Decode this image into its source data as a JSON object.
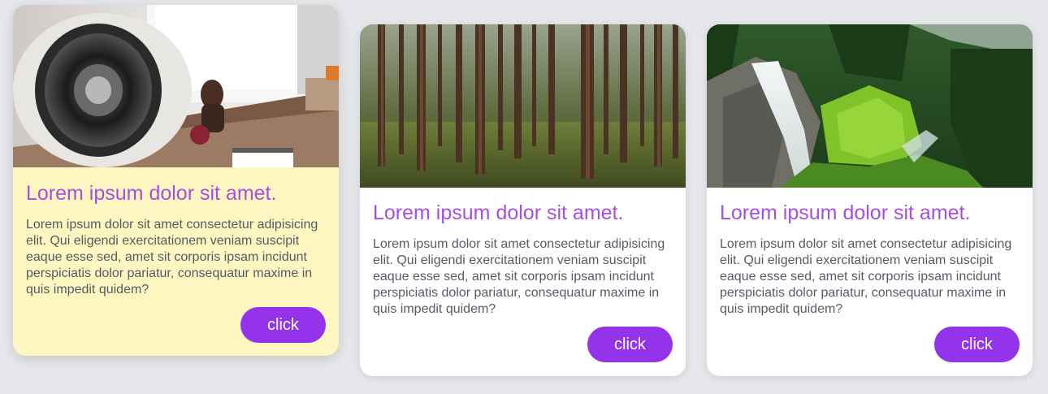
{
  "cards": [
    {
      "image": "desk-speaker-photo",
      "title": "Lorem ipsum dolor sit amet.",
      "text": "Lorem ipsum dolor sit amet consectetur adipisicing elit. Qui eligendi exercitationem veniam suscipit eaque esse sed, amet sit corporis ipsam incidunt perspiciatis dolor pariatur, consequatur maxime in quis impedit quidem?",
      "button_label": "click",
      "active": true
    },
    {
      "image": "pine-forest-photo",
      "title": "Lorem ipsum dolor sit amet.",
      "text": "Lorem ipsum dolor sit amet consectetur adipisicing elit. Qui eligendi exercitationem veniam suscipit eaque esse sed, amet sit corporis ipsam incidunt perspiciatis dolor pariatur, consequatur maxime in quis impedit quidem?",
      "button_label": "click",
      "active": false
    },
    {
      "image": "waterfall-photo",
      "title": "Lorem ipsum dolor sit amet.",
      "text": "Lorem ipsum dolor sit amet consectetur adipisicing elit. Qui eligendi exercitationem veniam suscipit eaque esse sed, amet sit corporis ipsam incidunt perspiciatis dolor pariatur, consequatur maxime in quis impedit quidem?",
      "button_label": "click",
      "active": false
    }
  ],
  "colors": {
    "page_background": "#e5e7eb",
    "card_background": "#ffffff",
    "active_card_background": "#fef6c0",
    "title": "#a64fe0",
    "body_text": "#555b66",
    "button": "#9333ea",
    "button_text": "#ffffff"
  }
}
